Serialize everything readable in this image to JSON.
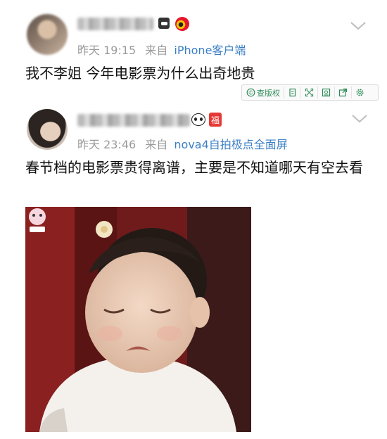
{
  "posts": [
    {
      "time": "昨天 19:15",
      "via": "来自",
      "source": "iPhone客户端",
      "text": "我不李姐 今年电影票为什么出奇地贵"
    },
    {
      "time": "昨天 23:46",
      "via": "来自",
      "source": "nova4自拍极点全面屏",
      "text": "春节档的电影票贵得离谱，主要是不知道哪天有空去看"
    }
  ],
  "toolbar": {
    "check_label": "查版权"
  },
  "colors": {
    "link": "#3b7fc4",
    "meta": "#9a9a9a",
    "toolbar_accent": "#2e8b57",
    "photo_background": "#6f1b1b"
  },
  "icons": [
    "smiley-badge-icon",
    "weibo-logo-icon",
    "panda-badge-icon",
    "fu-badge-icon",
    "chevron-down-icon",
    "copyright-check-icon",
    "copy-icon",
    "expand-icon",
    "save-icon",
    "share-icon",
    "settings-icon",
    "sticker-logo-icon"
  ],
  "badges": {
    "fu": "福"
  }
}
